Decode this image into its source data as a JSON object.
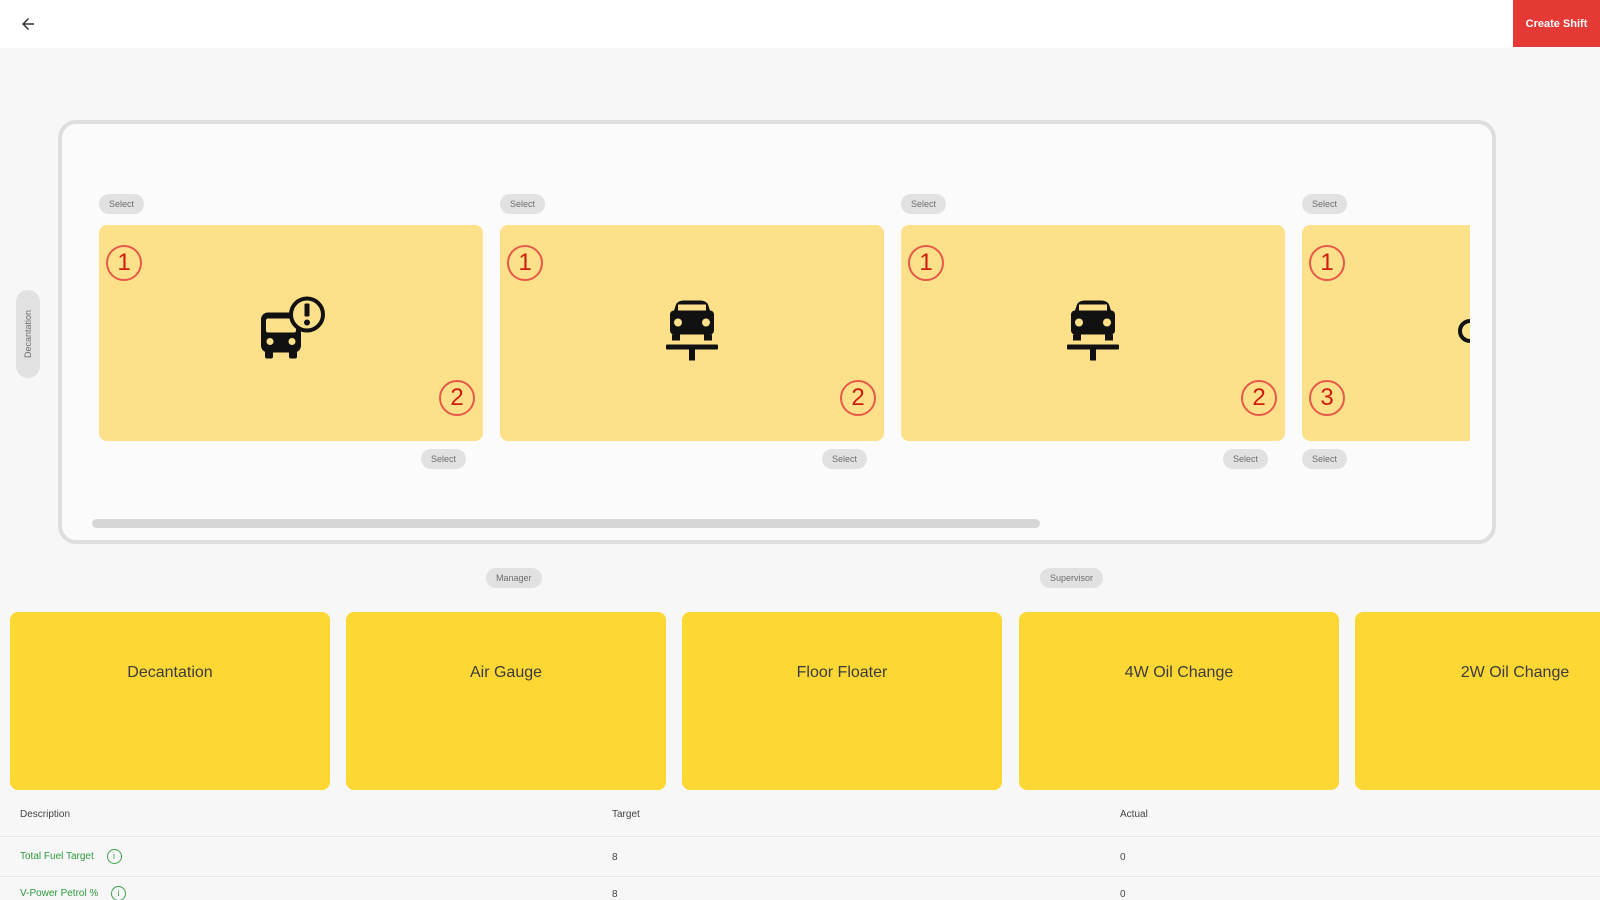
{
  "header": {
    "back_icon": "arrow-left-icon",
    "create_shift_label": "Create Shift",
    "create_shift_color": "#e53935"
  },
  "side_label": "Decantation",
  "slots": [
    {
      "top_select": "Select",
      "bottom_select": "Select",
      "top_badge": "1",
      "bottom_badge": "2",
      "icon": "bus-alert-icon"
    },
    {
      "top_select": "Select",
      "bottom_select": "Select",
      "top_badge": "1",
      "bottom_badge": "2",
      "icon": "car-lift-icon"
    },
    {
      "top_select": "Select",
      "bottom_select": "Select",
      "top_badge": "1",
      "bottom_badge": "2",
      "icon": "car-lift-icon"
    },
    {
      "top_select": "Select",
      "bottom_select": "Select",
      "top_badge": "1",
      "bottom_badge": "3",
      "icon": "partial-icon"
    }
  ],
  "roles": {
    "manager": "Manager",
    "supervisor": "Supervisor"
  },
  "tasks": [
    "Decantation",
    "Air Gauge",
    "Floor Floater",
    "4W Oil Change",
    "2W Oil Change"
  ],
  "table": {
    "headers": {
      "description": "Description",
      "target": "Target",
      "actual": "Actual"
    },
    "rows": [
      {
        "description": "Total Fuel Target",
        "target": "8",
        "actual": "0"
      },
      {
        "description": "V-Power Petrol %",
        "target": "8",
        "actual": "0"
      }
    ]
  },
  "colors": {
    "card_bg": "#fde08a",
    "task_bg": "#fdd835",
    "badge_red": "#d01c0e",
    "link_green": "#2e9b3e"
  }
}
